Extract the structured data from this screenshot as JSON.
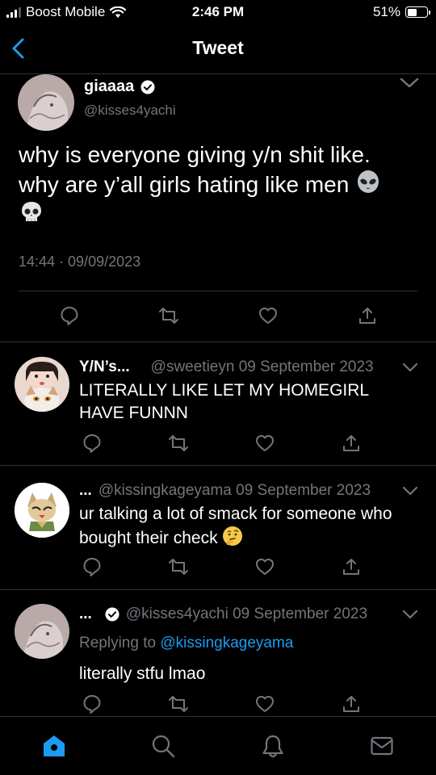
{
  "status_bar": {
    "carrier": "Boost Mobile",
    "time": "2:46 PM",
    "battery": "51%",
    "battery_level": 0.51
  },
  "header": {
    "title": "Tweet",
    "back_icon": "chevron-left-icon"
  },
  "main_tweet": {
    "name": "giaaaa",
    "handle": "@kisses4yachi",
    "text": "why is everyone giving y/n shit like. why are y’all girls hating like men",
    "emojis": [
      "alien-emoji",
      "skull-emoji"
    ],
    "timestamp": "14:44 · 09/09/2023",
    "verified_icon": "verified-badge-icon"
  },
  "replies": [
    {
      "name": "Y/N’s...",
      "meta": "@sweetieyn 09 September 2023",
      "text": "LITERALLY LIKE LET MY HOMEGIRL HAVE FUNNN"
    },
    {
      "name": "...",
      "meta": "@kissingkageyama 09 September 2023",
      "text": "ur talking a lot of smack for someone who bought their check",
      "emoji": "thinking-face-emoji"
    },
    {
      "name": "...",
      "meta": "@kisses4yachi 09 September 2023",
      "replying_prefix": "Replying to",
      "replying_to": "@kissingkageyama",
      "text": "literally stfu lmao"
    }
  ],
  "bottom_nav": {
    "items": [
      "home-icon",
      "search-icon",
      "notifications-icon",
      "messages-icon"
    ]
  },
  "colors": {
    "background": "#000000",
    "text": "#e7e9ea",
    "secondary": "#71767b",
    "accent": "#1d9bf0",
    "divider": "#2f3336"
  }
}
